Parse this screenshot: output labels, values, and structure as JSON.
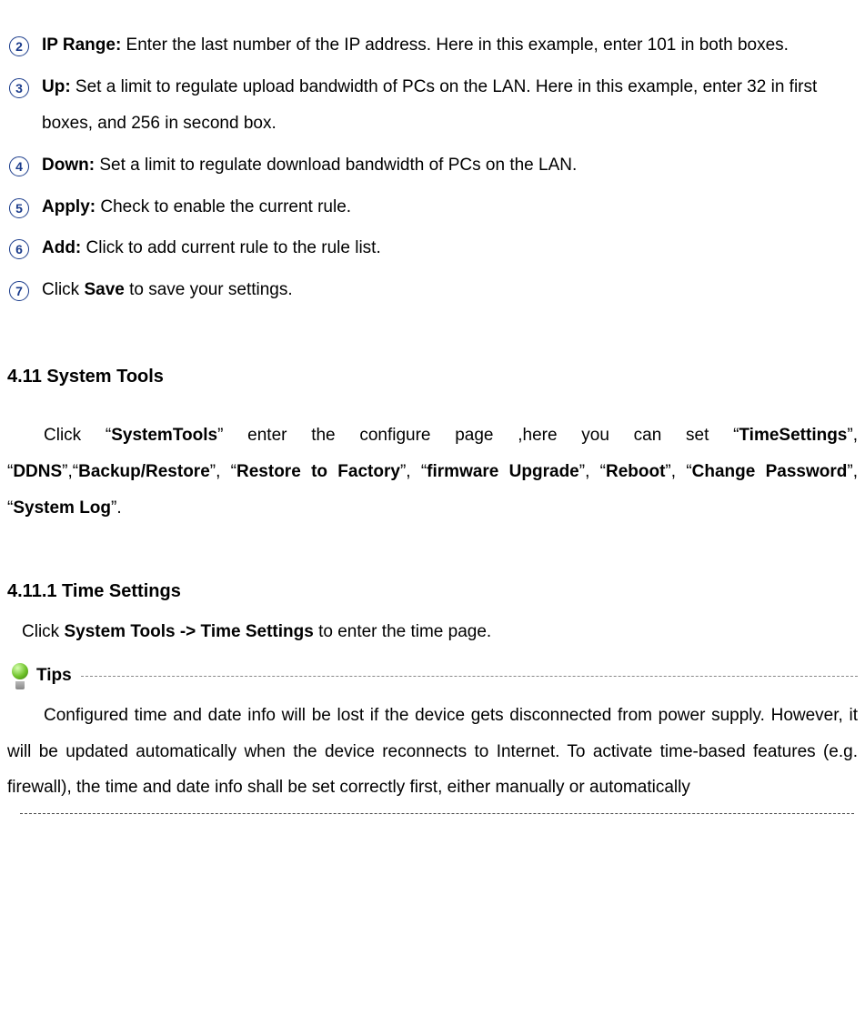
{
  "list": {
    "items": [
      {
        "num": "2",
        "label": "IP Range:",
        "text": " Enter the last number of the IP address. Here in this example, enter 101 in both boxes."
      },
      {
        "num": "3",
        "label": "Up:",
        "text": " Set a limit to regulate upload bandwidth of PCs on the LAN. Here in this example, enter 32 in first boxes, and 256 in second box."
      },
      {
        "num": "4",
        "label": "Down:",
        "text": " Set a limit to regulate download bandwidth of PCs on the LAN."
      },
      {
        "num": "5",
        "label": "Apply:",
        "text": " Check to enable the current rule."
      },
      {
        "num": "6",
        "label": "Add:",
        "text": " Click to add current rule to the rule list."
      }
    ],
    "final": {
      "num": "7",
      "pre": "Click ",
      "bold": "Save",
      "post": " to save your settings."
    }
  },
  "section": {
    "heading": "4.11 System Tools",
    "p": {
      "s0": "Click “",
      "b0": "SystemTools",
      "s1": "” enter the configure page ,here you can set “",
      "b1": "TimeSettings",
      "s2": "”, “",
      "b2": "DDNS",
      "s3": "”,“",
      "b3": "Backup/Restore",
      "s4": "”, “",
      "b4": "Restore to Factory",
      "s5": "”, “",
      "b5": "firmware Upgrade",
      "s6": "”, “",
      "b6": "Reboot",
      "s7": "”, “",
      "b7": "Change Password",
      "s8": "”, “",
      "b8": "System Log",
      "s9": "”."
    }
  },
  "sub": {
    "heading": "4.11.1 Time Settings",
    "click": {
      "pre": "Click ",
      "bold": "System Tools -> Time Settings",
      "post": " to enter the time page."
    },
    "tips_label": "Tips",
    "tips_body": "Configured time and date info will be lost if the device gets disconnected from power supply. However, it will be updated automatically when the device reconnects to Internet. To activate time-based features (e.g. firewall), the time and date info shall be set correctly first, either manually or automatically"
  }
}
